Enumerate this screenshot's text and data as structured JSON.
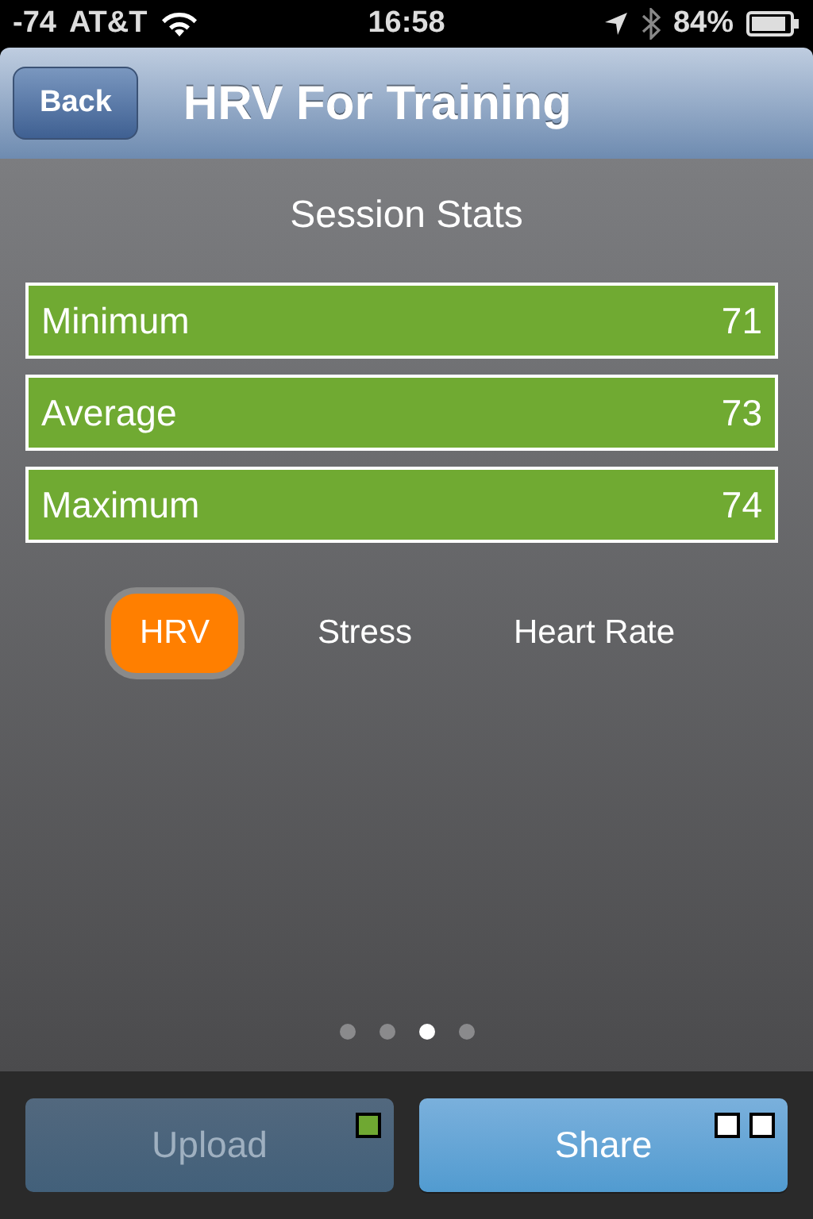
{
  "status_bar": {
    "signal": "-74",
    "carrier": "AT&T",
    "time": "16:58",
    "battery": "84%"
  },
  "nav": {
    "back": "Back",
    "title": "HRV For Training"
  },
  "section_title": "Session Stats",
  "stats": [
    {
      "label": "Minimum",
      "value": "71"
    },
    {
      "label": "Average",
      "value": "73"
    },
    {
      "label": "Maximum",
      "value": "74"
    }
  ],
  "tabs": [
    {
      "label": "HRV",
      "selected": true
    },
    {
      "label": "Stress",
      "selected": false
    },
    {
      "label": "Heart Rate",
      "selected": false
    }
  ],
  "pages": [
    {
      "selected": false
    },
    {
      "selected": false
    },
    {
      "selected": true
    },
    {
      "selected": false
    }
  ],
  "buttons": [
    {
      "label": "Upload",
      "disabled": true,
      "indicators": [
        {
          "color": "#6fa832"
        }
      ]
    },
    {
      "label": "Share",
      "disabled": false,
      "indicators": [
        {
          "color": "#ffffff"
        },
        {
          "color": "#ffffff"
        }
      ]
    }
  ]
}
